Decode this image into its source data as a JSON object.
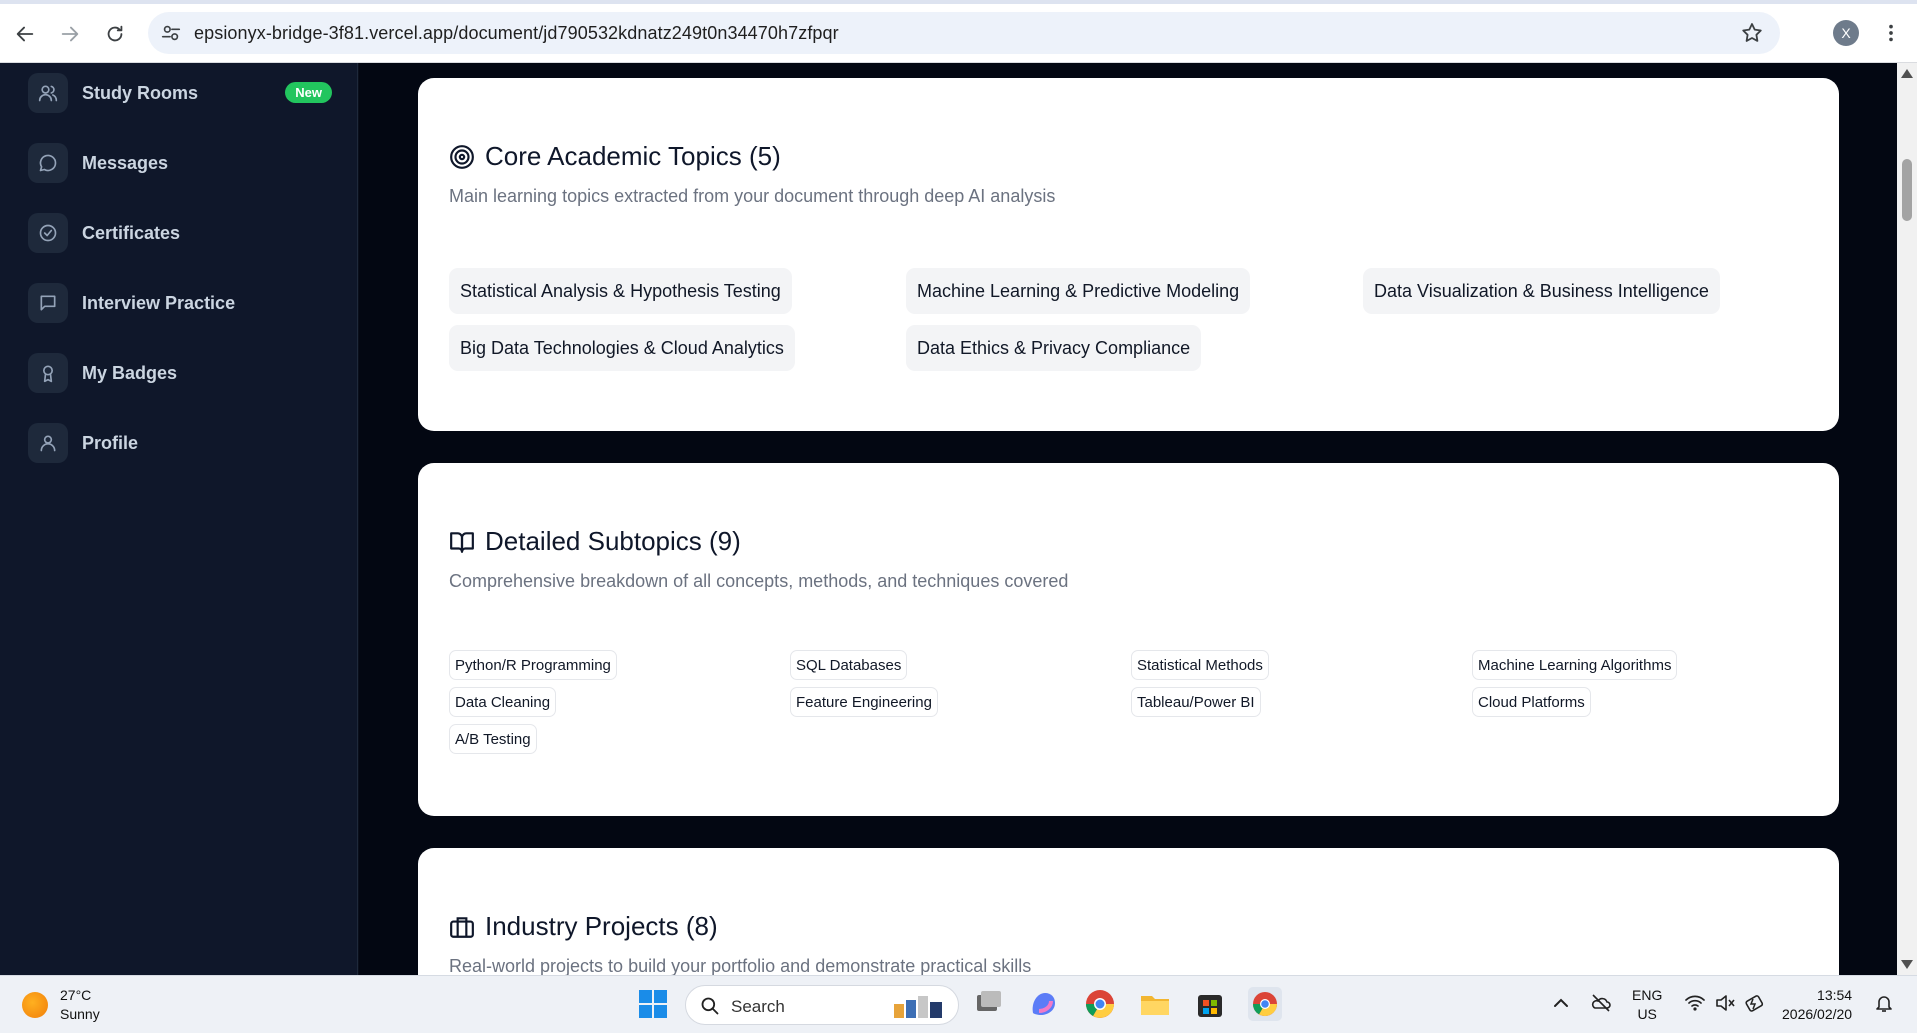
{
  "browser": {
    "url": "epsionyx-bridge-3f81.vercel.app/document/jd790532kdnatz249t0n34470h7zfpqr",
    "profile_initial": "X"
  },
  "sidebar": {
    "items": [
      {
        "label": "Study Rooms",
        "icon": "users-icon",
        "badge": "New"
      },
      {
        "label": "Messages",
        "icon": "message-circle-icon"
      },
      {
        "label": "Certificates",
        "icon": "check-circle-icon"
      },
      {
        "label": "Interview Practice",
        "icon": "message-square-icon"
      },
      {
        "label": "My Badges",
        "icon": "award-icon"
      },
      {
        "label": "Profile",
        "icon": "user-icon"
      }
    ]
  },
  "core_topics": {
    "title": "Core Academic Topics (5)",
    "subtitle": "Main learning topics extracted from your document through deep AI analysis",
    "items": [
      "Statistical Analysis & Hypothesis Testing",
      "Machine Learning & Predictive Modeling",
      "Data Visualization & Business Intelligence",
      "Big Data Technologies & Cloud Analytics",
      "Data Ethics & Privacy Compliance"
    ]
  },
  "subtopics": {
    "title": "Detailed Subtopics (9)",
    "subtitle": "Comprehensive breakdown of all concepts, methods, and techniques covered",
    "items": [
      "Python/R Programming",
      "SQL Databases",
      "Statistical Methods",
      "Machine Learning Algorithms",
      "Data Cleaning",
      "Feature Engineering",
      "Tableau/Power BI",
      "Cloud Platforms",
      "A/B Testing"
    ]
  },
  "projects": {
    "title": "Industry Projects (8)",
    "subtitle": "Real-world projects to build your portfolio and demonstrate practical skills"
  },
  "taskbar": {
    "weather_temp": "27°C",
    "weather_desc": "Sunny",
    "search_label": "Search",
    "lang_line1": "ENG",
    "lang_line2": "US",
    "time": "13:54",
    "date": "2026/02/20"
  },
  "colors": {
    "sidebar_bg": "#0f172a",
    "main_bg": "#030712",
    "badge_green": "#22c55e"
  }
}
